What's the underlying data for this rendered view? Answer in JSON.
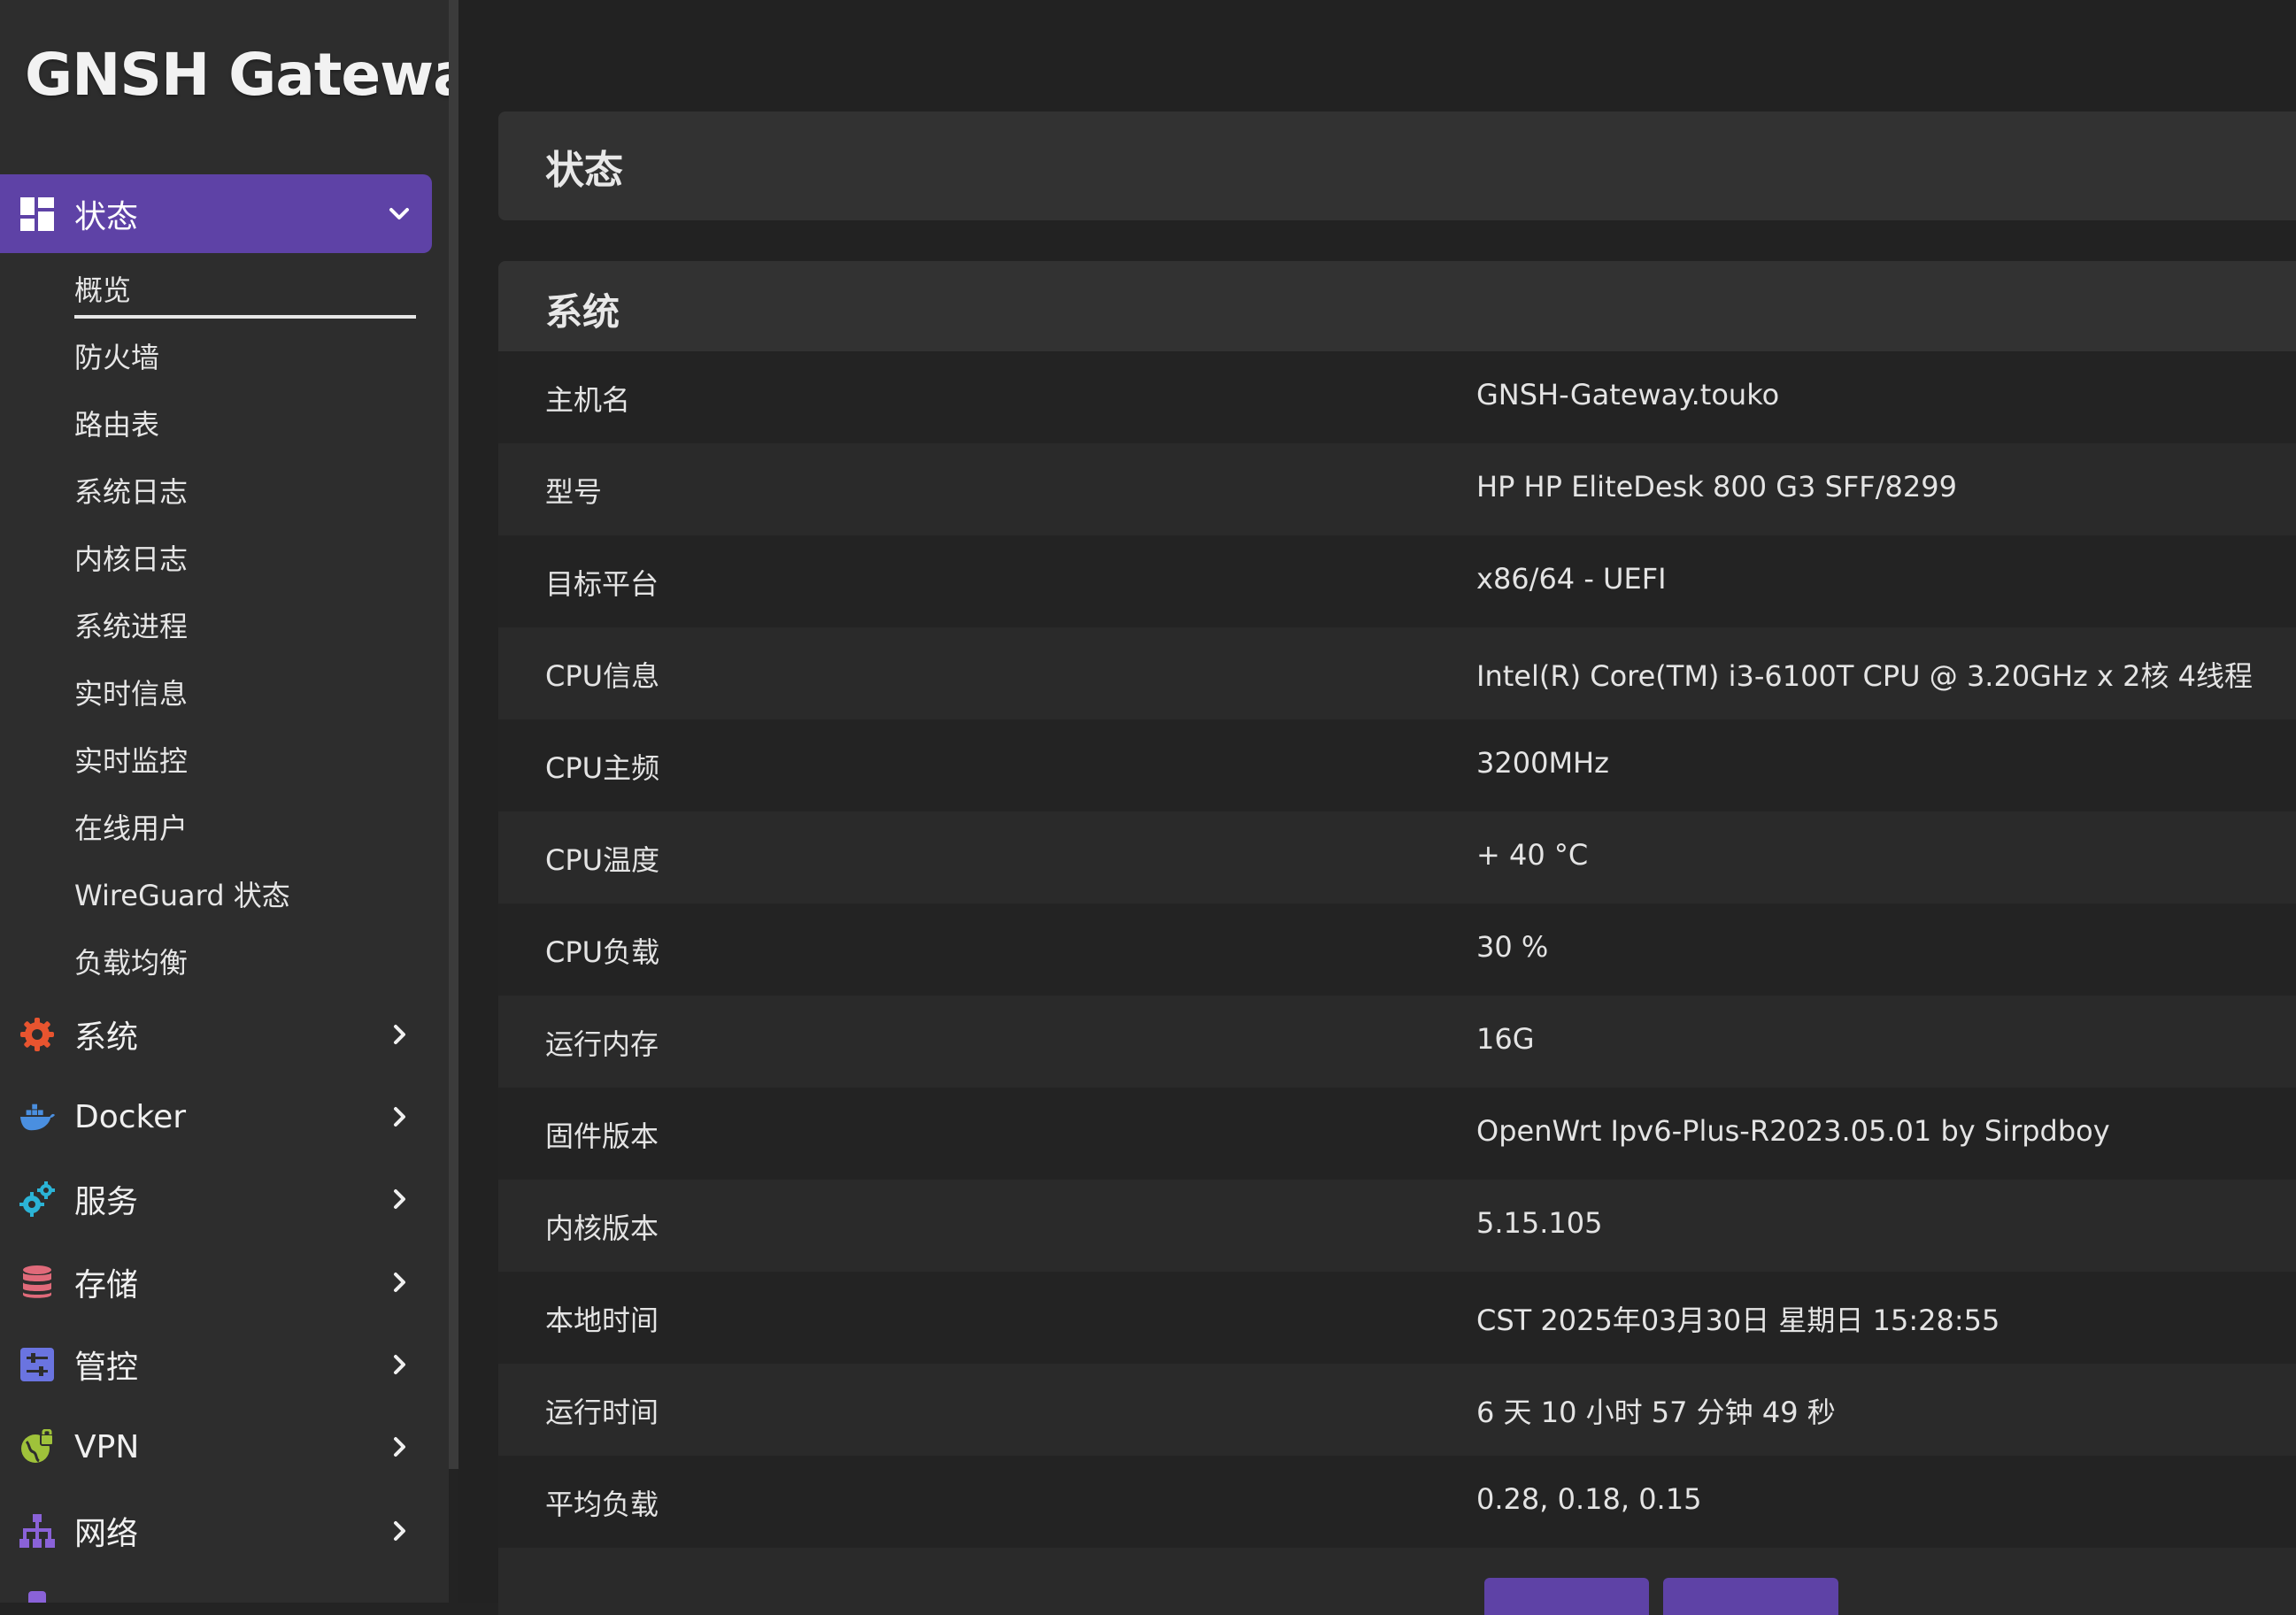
{
  "brand": "GNSH Gateway.t",
  "sidebar": {
    "active_menu": {
      "label": "状态",
      "icon": "dashboard-grid-icon"
    },
    "submenu": [
      "概览",
      "防火墙",
      "路由表",
      "系统日志",
      "内核日志",
      "系统进程",
      "实时信息",
      "实时监控",
      "在线用户",
      "WireGuard 状态",
      "负载均衡"
    ],
    "menus": [
      {
        "label": "系统",
        "icon": "gear-icon",
        "color": "#e8542f"
      },
      {
        "label": "Docker",
        "icon": "docker-whale-icon",
        "color": "#4a8fe0"
      },
      {
        "label": "服务",
        "icon": "cogs-icon",
        "color": "#2bb3d6"
      },
      {
        "label": "存储",
        "icon": "database-icon",
        "color": "#e06a7a"
      },
      {
        "label": "管控",
        "icon": "sliders-icon",
        "color": "#6a74e0"
      },
      {
        "label": "VPN",
        "icon": "globe-lock-icon",
        "color": "#9fc23a"
      },
      {
        "label": "网络",
        "icon": "network-tree-icon",
        "color": "#8a62d8"
      }
    ]
  },
  "main": {
    "page_title": "状态",
    "section_title": "系统",
    "rows": [
      {
        "label": "主机名",
        "value": "GNSH-Gateway.touko"
      },
      {
        "label": "型号",
        "value": "HP HP EliteDesk 800 G3 SFF/8299"
      },
      {
        "label": "目标平台",
        "value": "x86/64 - UEFI"
      },
      {
        "label": "CPU信息",
        "value": "Intel(R) Core(TM) i3-6100T CPU @ 3.20GHz x 2核 4线程"
      },
      {
        "label": "CPU主频",
        "value": "3200MHz"
      },
      {
        "label": "CPU温度",
        "value": "+ 40 °C"
      },
      {
        "label": "CPU负载",
        "value": "30 %"
      },
      {
        "label": "运行内存",
        "value": "16G"
      },
      {
        "label": "固件版本",
        "value": "OpenWrt Ipv6-Plus-R2023.05.01 by Sirpdboy"
      },
      {
        "label": "内核版本",
        "value": "5.15.105"
      },
      {
        "label": "本地时间",
        "value": "CST 2025年03月30日 星期日 15:28:55"
      },
      {
        "label": "运行时间",
        "value": "6 天 10 小时 57 分钟 49 秒"
      },
      {
        "label": "平均负载",
        "value": "0.28, 0.18, 0.15"
      }
    ]
  },
  "colors": {
    "accent": "#5e42a6",
    "sidebar_bg": "#2d2d2d",
    "main_bg": "#222222"
  }
}
